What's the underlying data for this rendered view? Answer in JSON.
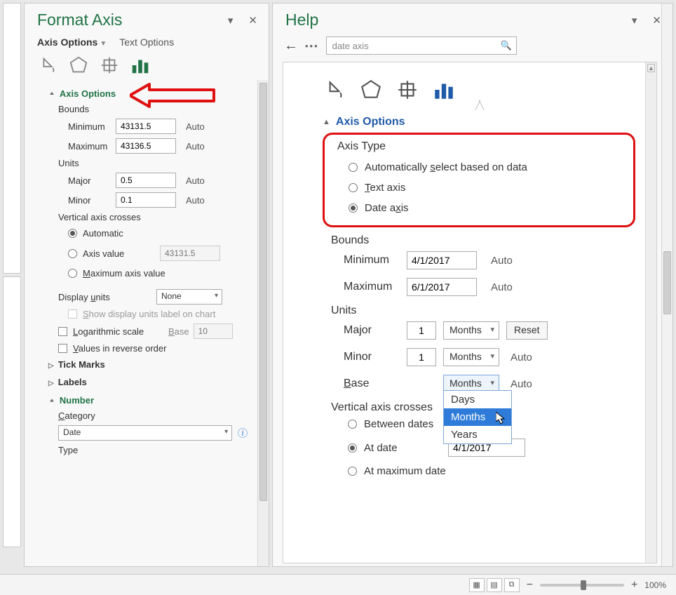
{
  "left": {
    "title": "Format Axis",
    "tabs": {
      "options": "Axis Options",
      "text": "Text Options"
    },
    "section": "Axis Options",
    "bounds": {
      "heading": "Bounds",
      "min_label": "Minimum",
      "min_value": "43131.5",
      "min_auto": "Auto",
      "max_label": "Maximum",
      "max_value": "43136.5",
      "max_auto": "Auto"
    },
    "units": {
      "heading": "Units",
      "major_label": "Major",
      "major_value": "0.5",
      "major_auto": "Auto",
      "minor_label": "Minor",
      "minor_value": "0.1",
      "minor_auto": "Auto"
    },
    "vcross": {
      "heading": "Vertical axis crosses",
      "auto": "Automatic",
      "value_label": "Axis value",
      "value": "43131.5",
      "max": "Maximum axis value"
    },
    "display_units": {
      "label": "Display units",
      "value": "None",
      "show_label": "Show display units label on chart"
    },
    "log": {
      "label": "Logarithmic scale",
      "base_label": "Base",
      "base_value": "10"
    },
    "reverse": "Values in reverse order",
    "tickmarks": "Tick Marks",
    "labels": "Labels",
    "number": {
      "heading": "Number",
      "cat_label": "Category",
      "cat_value": "Date",
      "type_label": "Type"
    }
  },
  "right": {
    "title": "Help",
    "search": "date axis",
    "section": "Axis Options",
    "axistype": {
      "heading": "Axis Type",
      "auto": "Automatically select based on data",
      "text": "Text axis",
      "date": "Date axis"
    },
    "bounds": {
      "heading": "Bounds",
      "min_label": "Minimum",
      "min_value": "4/1/2017",
      "min_auto": "Auto",
      "max_label": "Maximum",
      "max_value": "6/1/2017",
      "max_auto": "Auto"
    },
    "units": {
      "heading": "Units",
      "major_label": "Major",
      "major_num": "1",
      "major_unit": "Months",
      "major_btn": "Reset",
      "minor_label": "Minor",
      "minor_num": "1",
      "minor_unit": "Months",
      "minor_auto": "Auto",
      "base_label": "Base",
      "base_unit": "Months",
      "base_auto": "Auto",
      "dropdown": {
        "days": "Days",
        "months": "Months",
        "years": "Years"
      }
    },
    "vcross": {
      "heading": "Vertical axis crosses",
      "between": "Between dates",
      "at": "At date",
      "at_value": "4/1/2017",
      "max": "At maximum date"
    }
  },
  "status": {
    "zoom": "100%"
  }
}
